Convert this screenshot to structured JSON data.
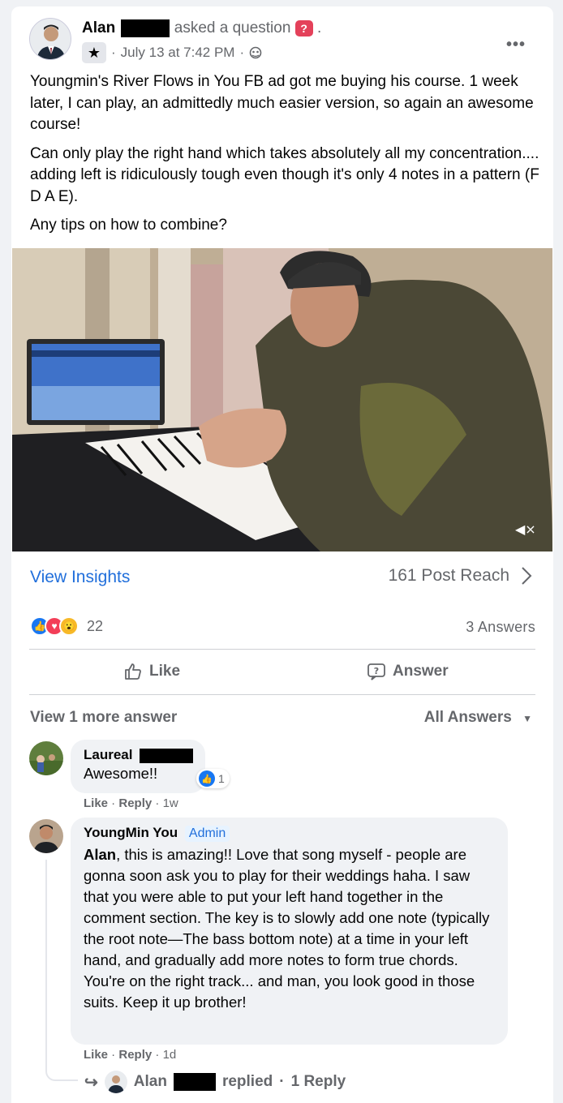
{
  "post": {
    "author_first": "Alan",
    "action_text": "asked a question",
    "question_icon": "?",
    "trailing_dot": ".",
    "date": "July 13 at 7:42 PM",
    "separator": "·",
    "more_label": "•••",
    "paragraphs": [
      "Youngmin's River Flows in You FB ad got me buying his course. 1 week later, I can play, an admittedly much easier version, so again an awesome course!",
      "Can only play the right hand which takes absolutely all my concentration.... adding left is ridiculously tough even though it's only 4 notes in a pattern (F D A E).",
      "Any tips on how to combine?"
    ]
  },
  "insights": {
    "view_label": "View Insights",
    "reach_label": "161 Post Reach"
  },
  "reactions": {
    "count": "22",
    "answers_label": "3 Answers"
  },
  "actions": {
    "like_label": "Like",
    "answer_label": "Answer"
  },
  "answers_bar": {
    "view_more_label": "View 1 more answer",
    "filter_label": "All Answers"
  },
  "comments": [
    {
      "name": "Laureal",
      "text": "Awesome!!",
      "like_count": "1",
      "like_label": "Like",
      "reply_label": "Reply",
      "time": "1w"
    },
    {
      "name": "YoungMin You",
      "badge": "Admin",
      "mention": "Alan",
      "text": ", this is amazing!! Love that song myself - people are gonna soon ask you to play for their weddings haha. I saw that you were able to put your left hand together in the comment section. The key is to slowly add one note (typically the root note—The bass bottom note) at a time in your left hand, and gradually add more notes to form true chords. You're on the right track... and man, you look good in those suits. Keep it up brother!",
      "like_label": "Like",
      "reply_label": "Reply",
      "time": "1d"
    }
  ],
  "reply_summary": {
    "name": "Alan",
    "replied_label": "replied",
    "replies_label": "1 Reply"
  }
}
